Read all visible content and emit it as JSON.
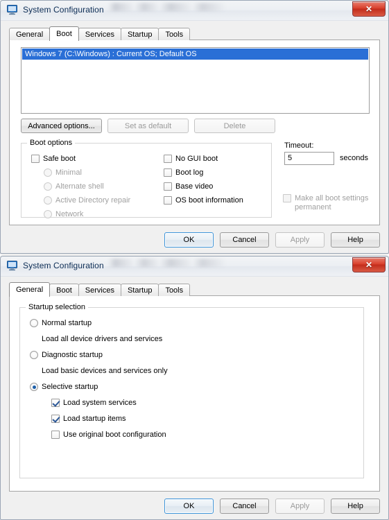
{
  "windows": [
    {
      "title": "System Configuration",
      "icon": "computer-monitor-icon",
      "close_label": "✕",
      "active_tab": "Boot",
      "tabs": [
        "General",
        "Boot",
        "Services",
        "Startup",
        "Tools"
      ],
      "boot": {
        "os_entries": [
          "Windows 7 (C:\\Windows) : Current OS; Default OS"
        ],
        "buttons": [
          {
            "label": "Advanced options...",
            "enabled": true
          },
          {
            "label": "Set as default",
            "enabled": false
          },
          {
            "label": "Delete",
            "enabled": false
          }
        ],
        "group_legend": "Boot options",
        "safe_boot": {
          "label": "Safe boot",
          "checked": false,
          "enabled": true
        },
        "safe_boot_modes": [
          {
            "label": "Minimal",
            "selected": false,
            "enabled": false
          },
          {
            "label": "Alternate shell",
            "selected": false,
            "enabled": false
          },
          {
            "label": "Active Directory repair",
            "selected": false,
            "enabled": false
          },
          {
            "label": "Network",
            "selected": false,
            "enabled": false
          }
        ],
        "flags": [
          {
            "label": "No GUI boot",
            "checked": false,
            "enabled": true
          },
          {
            "label": "Boot log",
            "checked": false,
            "enabled": true
          },
          {
            "label": "Base video",
            "checked": false,
            "enabled": true
          },
          {
            "label": "OS boot information",
            "checked": false,
            "enabled": true
          }
        ],
        "timeout_label": "Timeout:",
        "timeout_value": "5",
        "timeout_units": "seconds",
        "permanent": {
          "label": "Make all boot settings permanent",
          "checked": false,
          "enabled": false
        }
      },
      "footer": [
        {
          "label": "OK",
          "enabled": true,
          "default": true
        },
        {
          "label": "Cancel",
          "enabled": true,
          "default": false
        },
        {
          "label": "Apply",
          "enabled": false,
          "default": false
        },
        {
          "label": "Help",
          "enabled": true,
          "default": false
        }
      ]
    },
    {
      "title": "System Configuration",
      "icon": "computer-monitor-icon",
      "close_label": "✕",
      "active_tab": "General",
      "tabs": [
        "General",
        "Boot",
        "Services",
        "Startup",
        "Tools"
      ],
      "general": {
        "group_legend": "Startup selection",
        "options": [
          {
            "label": "Normal startup",
            "description": "Load all device drivers and services",
            "selected": false
          },
          {
            "label": "Diagnostic startup",
            "description": "Load basic devices and services only",
            "selected": false
          },
          {
            "label": "Selective startup",
            "description": "",
            "selected": true
          }
        ],
        "selective_items": [
          {
            "label": "Load system services",
            "checked": true,
            "enabled": true
          },
          {
            "label": "Load startup items",
            "checked": true,
            "enabled": true
          },
          {
            "label": "Use original boot configuration",
            "checked": false,
            "enabled": true
          }
        ]
      },
      "footer": [
        {
          "label": "OK",
          "enabled": true,
          "default": true
        },
        {
          "label": "Cancel",
          "enabled": true,
          "default": false
        },
        {
          "label": "Apply",
          "enabled": false,
          "default": false
        },
        {
          "label": "Help",
          "enabled": true,
          "default": false
        }
      ]
    }
  ],
  "colors": {
    "selection_blue": "#2a6fd6",
    "close_red": "#d9402c",
    "title_text": "#0b2c54",
    "disabled_text": "#a0a0a0"
  }
}
